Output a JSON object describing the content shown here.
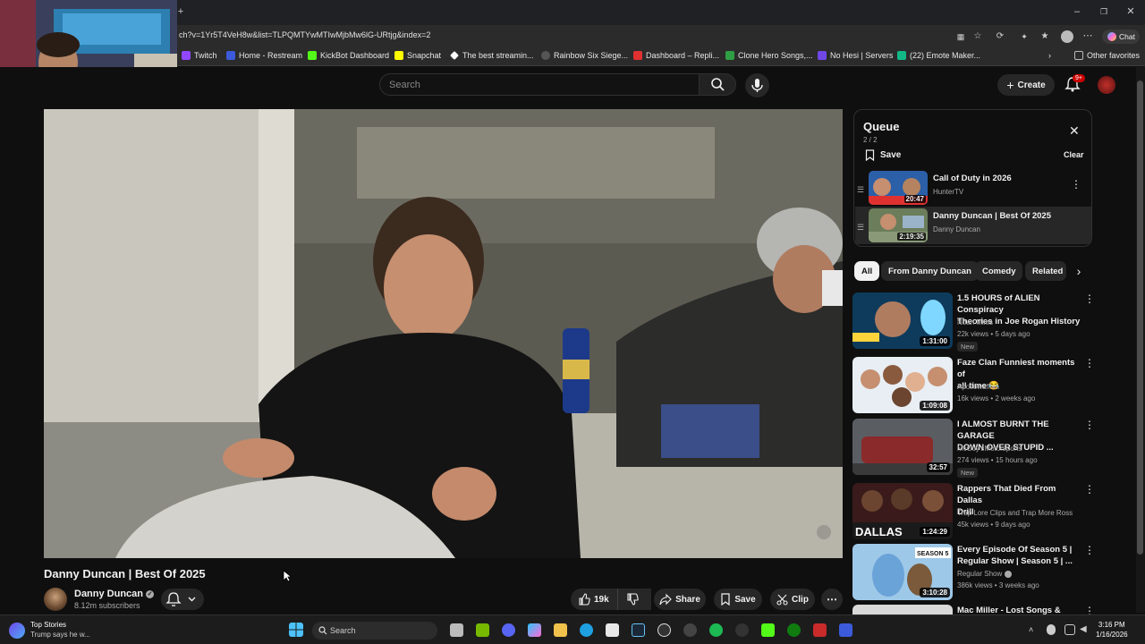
{
  "browser": {
    "url": "ch?v=1Yr5T4VeH8w&list=TLPQMTYwMTIwMjbMw6lG-URtjg&index=2",
    "chat_label": "Chat",
    "bookmarks": [
      {
        "label": "Twitch",
        "color": "#9146ff"
      },
      {
        "label": "Home - Restream",
        "color": "#3b5bdb"
      },
      {
        "label": "KickBot Dashboard",
        "color": "#53fc18"
      },
      {
        "label": "Snapchat",
        "color": "#fffc00"
      },
      {
        "label": "The best streamin...",
        "color": "#ffffff"
      },
      {
        "label": "Rainbow Six Siege...",
        "color": "#888888"
      },
      {
        "label": "Dashboard – Repli...",
        "color": "#e03131"
      },
      {
        "label": "Clone Hero Songs,...",
        "color": "#2f9e44"
      },
      {
        "label": "No Hesi | Servers",
        "color": "#7048e8"
      },
      {
        "label": "(22) Emote Maker...",
        "color": "#12b886"
      }
    ],
    "other_favorites": "Other favorites"
  },
  "header": {
    "search_placeholder": "Search",
    "create_label": "Create",
    "notif_count": "9+"
  },
  "video": {
    "title": "Danny Duncan | Best Of 2025",
    "channel": "Danny Duncan",
    "subscribers": "8.12m subscribers",
    "likes": "19k",
    "share_label": "Share",
    "save_label": "Save",
    "clip_label": "Clip"
  },
  "queue": {
    "title": "Queue",
    "count": "2 / 2",
    "save_label": "Save",
    "clear_label": "Clear",
    "items": [
      {
        "title": "Call of Duty in 2026",
        "channel": "HunterTV",
        "duration": "20:47"
      },
      {
        "title": "Danny Duncan | Best Of 2025",
        "channel": "Danny Duncan",
        "duration": "2:19:35"
      }
    ]
  },
  "chips": [
    "All",
    "From Danny Duncan",
    "Comedy",
    "Related"
  ],
  "recommended": [
    {
      "title_1": "1.5 HOURS of ALIEN Conspiracy",
      "title_2": "Theories in Joe Rogan History",
      "channel": "Noah Miles",
      "meta": "22k views • 5 days ago",
      "badge": "New",
      "duration": "1:31:00"
    },
    {
      "title_1": "Faze Clan Funniest moments of",
      "title_2": "all time 😂",
      "channel": "Apollowaffles",
      "meta": "16k views • 2 weeks ago",
      "badge": "",
      "duration": "1:09:08"
    },
    {
      "title_1": "I ALMOST BURNT THE GARAGE",
      "title_2": "DOWN OVER STUPID ...",
      "channel": "McCoy'sMotorsports",
      "meta": "274 views • 15 hours ago",
      "badge": "New",
      "duration": "32:57"
    },
    {
      "title_1": "Rappers That Died From Dallas",
      "title_2": "Drill",
      "channel": "Trap Lore Clips and Trap More Ross",
      "meta": "45k views • 9 days ago",
      "badge": "",
      "duration": "1:24:29"
    },
    {
      "title_1": "Every Episode Of Season 5 |",
      "title_2": "Regular Show | Season 5 | ...",
      "channel": "Regular Show",
      "meta": "386k views • 3 weeks ago",
      "badge": "",
      "duration": "3:10:28"
    },
    {
      "title_1": "Mac Miller - Lost Songs &",
      "title_2": "",
      "channel": "",
      "meta": "",
      "badge": "",
      "duration": ""
    }
  ],
  "thumb_texts": {
    "dallas": "DALLAS",
    "season": "SEASON 5"
  },
  "taskbar": {
    "news_title": "Top Stories",
    "news_sub": "Trump says he w...",
    "search_label": "Search",
    "time": "3:16 PM",
    "date": "1/16/2026"
  }
}
